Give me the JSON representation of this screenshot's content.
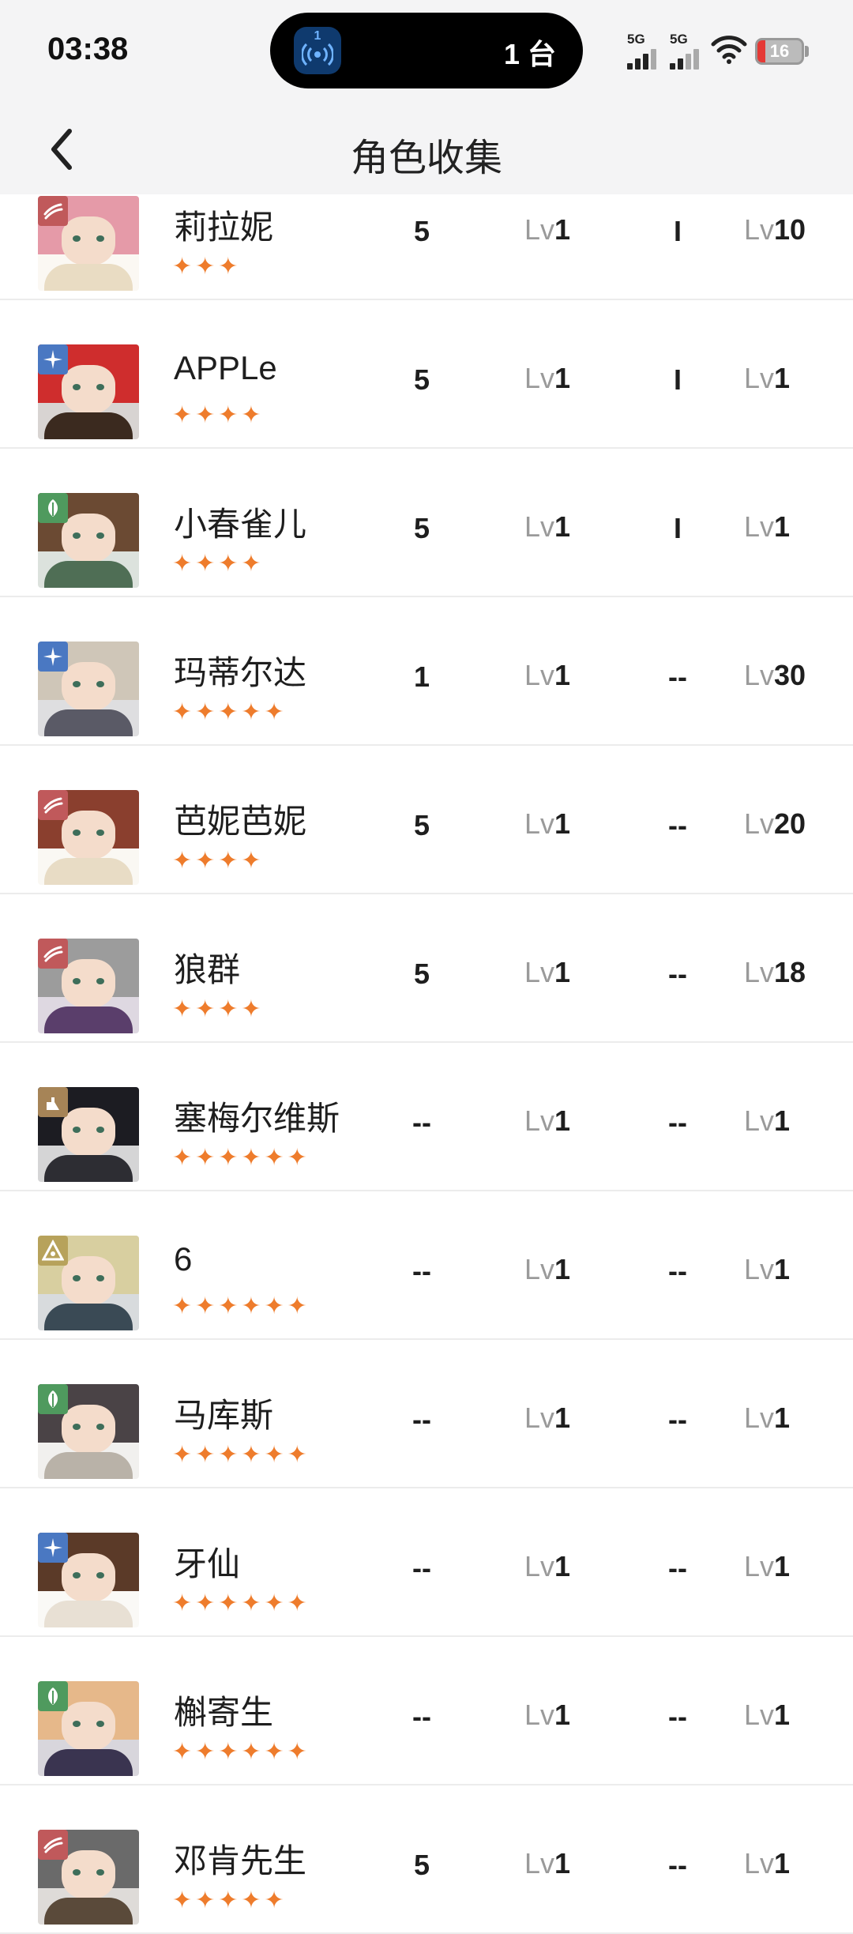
{
  "status_bar": {
    "time": "03:38",
    "island_badge": "1",
    "island_text": "1 台",
    "signal1_label": "5G",
    "signal2_label": "5G",
    "battery": "16",
    "battery_color": "#e53935"
  },
  "header": {
    "title": "角色收集",
    "back_icon": "chevron-left-icon"
  },
  "level_prefix": "Lv",
  "star_color": "#ee7c2c",
  "characters": [
    {
      "name": "莉拉妮",
      "stars": 3,
      "stars_text": "✦✦✦",
      "col1": "5",
      "lv1": "1",
      "col3": "I",
      "lv2": "10",
      "element": "claw",
      "element_color": "#c0595b",
      "hair": "#e59aa8",
      "outfit": "#e9dcc3"
    },
    {
      "name": "APPLe",
      "stars": 4,
      "stars_text": "✦✦✦✦",
      "col1": "5",
      "lv1": "1",
      "col3": "I",
      "lv2": "1",
      "element": "star",
      "element_color": "#4a78c2",
      "hair": "#cf2d2d",
      "outfit": "#3b2a1f"
    },
    {
      "name": "小春雀儿",
      "stars": 4,
      "stars_text": "✦✦✦✦",
      "col1": "5",
      "lv1": "1",
      "col3": "I",
      "lv2": "1",
      "element": "leaf",
      "element_color": "#4f9a5e",
      "hair": "#6b4a33",
      "outfit": "#4f6e55"
    },
    {
      "name": "玛蒂尔达",
      "stars": 5,
      "stars_text": "✦✦✦✦✦",
      "col1": "1",
      "lv1": "1",
      "col3": "--",
      "lv2": "30",
      "element": "star",
      "element_color": "#4a78c2",
      "hair": "#cfc6b8",
      "outfit": "#5a5a66"
    },
    {
      "name": "芭妮芭妮",
      "stars": 4,
      "stars_text": "✦✦✦✦",
      "col1": "5",
      "lv1": "1",
      "col3": "--",
      "lv2": "20",
      "element": "claw",
      "element_color": "#c0595b",
      "hair": "#8a3f2e",
      "outfit": "#e8dcc5"
    },
    {
      "name": "狼群",
      "stars": 4,
      "stars_text": "✦✦✦✦",
      "col1": "5",
      "lv1": "1",
      "col3": "--",
      "lv2": "18",
      "element": "claw",
      "element_color": "#c0595b",
      "hair": "#9c9c9c",
      "outfit": "#5a3e6b"
    },
    {
      "name": "塞梅尔维斯",
      "stars": 6,
      "stars_text": "✦✦✦✦✦✦",
      "col1": "--",
      "lv1": "1",
      "col3": "--",
      "lv2": "1",
      "element": "flask",
      "element_color": "#a68457",
      "hair": "#1c1c22",
      "outfit": "#2d2d33"
    },
    {
      "name": "6",
      "stars": 6,
      "stars_text": "✦✦✦✦✦✦",
      "col1": "--",
      "lv1": "1",
      "col3": "--",
      "lv2": "1",
      "element": "pyramid",
      "element_color": "#b7a25b",
      "hair": "#d8cfa0",
      "outfit": "#3a4a55"
    },
    {
      "name": "马库斯",
      "stars": 6,
      "stars_text": "✦✦✦✦✦✦",
      "col1": "--",
      "lv1": "1",
      "col3": "--",
      "lv2": "1",
      "element": "leaf",
      "element_color": "#4f9a5e",
      "hair": "#4a4346",
      "outfit": "#b9b2a8"
    },
    {
      "name": "牙仙",
      "stars": 6,
      "stars_text": "✦✦✦✦✦✦",
      "col1": "--",
      "lv1": "1",
      "col3": "--",
      "lv2": "1",
      "element": "star",
      "element_color": "#4a78c2",
      "hair": "#5b3a28",
      "outfit": "#e8e0d4"
    },
    {
      "name": "槲寄生",
      "stars": 6,
      "stars_text": "✦✦✦✦✦✦",
      "col1": "--",
      "lv1": "1",
      "col3": "--",
      "lv2": "1",
      "element": "leaf",
      "element_color": "#4f9a5e",
      "hair": "#e6b88a",
      "outfit": "#3a3450"
    },
    {
      "name": "邓肯先生",
      "stars": 5,
      "stars_text": "✦✦✦✦✦",
      "col1": "5",
      "lv1": "1",
      "col3": "--",
      "lv2": "1",
      "element": "claw",
      "element_color": "#c0595b",
      "hair": "#6a6a6a",
      "outfit": "#5a4a3a"
    }
  ]
}
